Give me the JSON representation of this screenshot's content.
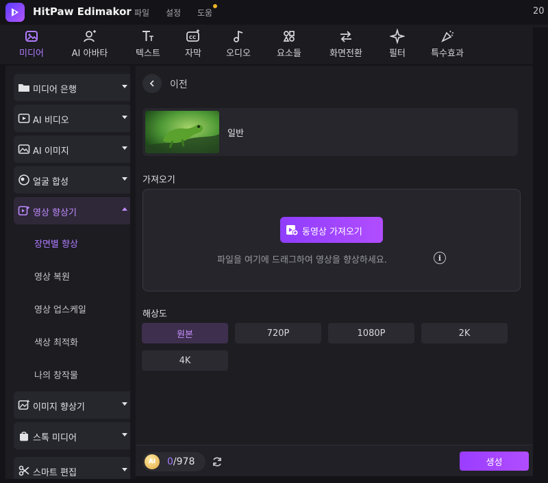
{
  "app": {
    "title": "HitPaw Edimakor",
    "year_fragment": "20"
  },
  "menu": {
    "items": [
      "파일",
      "설정",
      "도움"
    ]
  },
  "toolbar": {
    "items": [
      {
        "label": "미디어",
        "icon": "media-icon",
        "active": true
      },
      {
        "label": "AI 아바타",
        "icon": "avatar-icon",
        "active": false
      },
      {
        "label": "텍스트",
        "icon": "text-icon",
        "active": false
      },
      {
        "label": "자막",
        "icon": "subtitle-icon",
        "active": false
      },
      {
        "label": "오디오",
        "icon": "audio-icon",
        "active": false
      },
      {
        "label": "요소들",
        "icon": "elements-icon",
        "active": false
      },
      {
        "label": "화면전환",
        "icon": "transition-icon",
        "active": false
      },
      {
        "label": "필터",
        "icon": "filter-icon",
        "active": false
      },
      {
        "label": "특수효과",
        "icon": "effects-icon",
        "active": false
      }
    ]
  },
  "sidebar": {
    "categories": [
      {
        "label": "미디어 은행",
        "icon": "folder-icon"
      },
      {
        "label": "AI 비디오",
        "icon": "ai-video-icon"
      },
      {
        "label": "AI 이미지",
        "icon": "ai-image-icon"
      },
      {
        "label": "얼굴 합성",
        "icon": "face-swap-icon"
      },
      {
        "label": "영상 향상기",
        "icon": "video-enhancer-icon",
        "active": true
      },
      {
        "label": "이미지 향상기",
        "icon": "image-enhancer-icon"
      },
      {
        "label": "스톡 미디어",
        "icon": "stock-media-icon"
      },
      {
        "label": "스마트 편집",
        "icon": "smart-edit-icon"
      }
    ],
    "subitems": [
      {
        "label": "장면별 향상",
        "active": true
      },
      {
        "label": "영상 복원"
      },
      {
        "label": "영상 업스케일"
      },
      {
        "label": "색상 최적화"
      },
      {
        "label": "나의 창작물"
      }
    ]
  },
  "main": {
    "back_label": "이전",
    "model_name": "일반",
    "import_section": "가져오기",
    "import_button": "동영상 가져오기",
    "drop_hint": "파일을 여기에 드래그하여 영상을 향상하세요.",
    "info": "i",
    "resolution_section": "해상도",
    "resolutions": [
      {
        "label": "원본",
        "active": true
      },
      {
        "label": "720P"
      },
      {
        "label": "1080P"
      },
      {
        "label": "2K"
      },
      {
        "label": "4K"
      }
    ]
  },
  "footer": {
    "coin_label": "AI",
    "credits_used": "0",
    "credits_total": "/978",
    "generate_label": "생성"
  },
  "colors": {
    "accent": "#a66bff",
    "background": "#141418",
    "panel": "#1d1d22"
  }
}
